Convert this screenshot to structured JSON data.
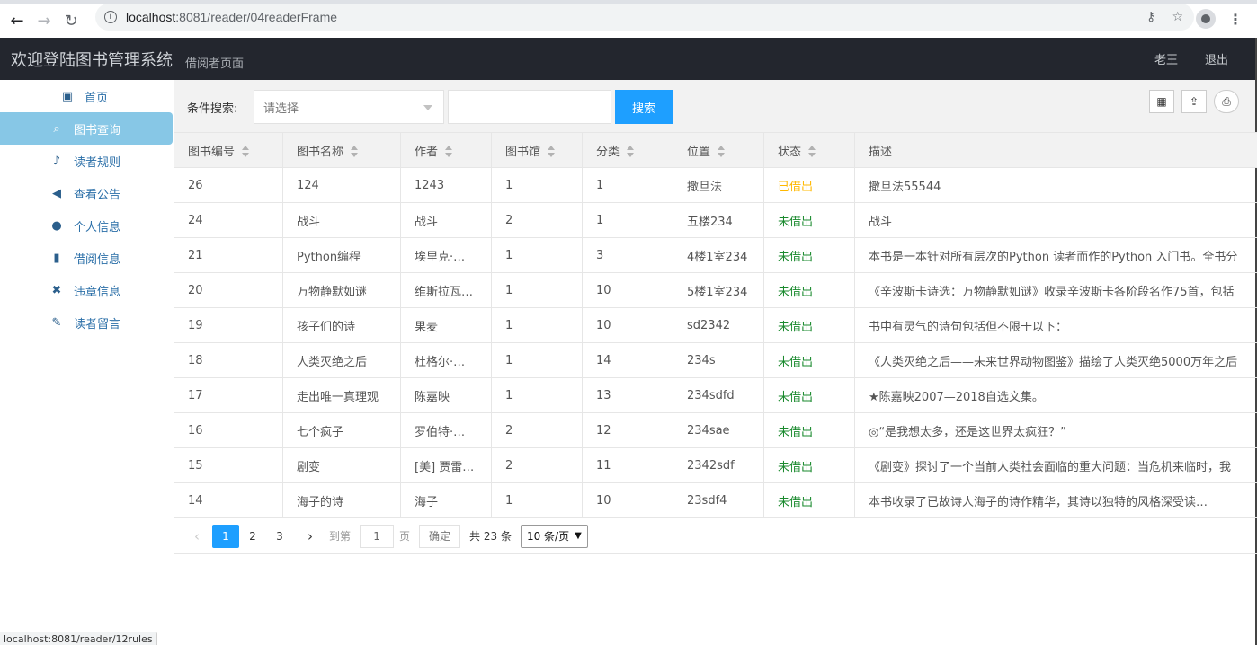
{
  "browser": {
    "url_host": "localhost",
    "url_path": ":8081/reader/04readerFrame",
    "status_url": "localhost:8081/reader/12rules"
  },
  "header": {
    "title": "欢迎登陆图书管理系统",
    "subtitle": "借阅者页面",
    "user": "老王",
    "logout": "退出"
  },
  "sidebar": {
    "items": [
      {
        "label": "首页",
        "icon": "image-icon"
      },
      {
        "label": "图书查询",
        "icon": "search-icon"
      },
      {
        "label": "读者规则",
        "icon": "bell-icon"
      },
      {
        "label": "查看公告",
        "icon": "bullhorn-icon"
      },
      {
        "label": "个人信息",
        "icon": "user-icon"
      },
      {
        "label": "借阅信息",
        "icon": "book-icon"
      },
      {
        "label": "违章信息",
        "icon": "remove-icon"
      },
      {
        "label": "读者留言",
        "icon": "pencil-icon"
      }
    ],
    "active": "图书查询"
  },
  "search": {
    "label": "条件搜索:",
    "select_placeholder": "请选择",
    "input_value": "",
    "button": "搜索"
  },
  "table": {
    "headers": [
      "图书编号",
      "图书名称",
      "作者",
      "图书馆",
      "分类",
      "位置",
      "状态",
      "描述"
    ],
    "rows": [
      [
        "26",
        "124",
        "1243",
        "1",
        "1",
        "撒旦法",
        "已借出",
        "撒旦法55544"
      ],
      [
        "24",
        "战斗",
        "战斗",
        "2",
        "1",
        "五楼234",
        "未借出",
        "战斗"
      ],
      [
        "21",
        "Python编程",
        "埃里克·…",
        "1",
        "3",
        "4楼1室234",
        "未借出",
        "本书是一本针对所有层次的Python 读者而作的Python 入门书。全书分"
      ],
      [
        "20",
        "万物静默如谜",
        "维斯拉瓦…",
        "1",
        "10",
        "5楼1室234",
        "未借出",
        "《辛波斯卡诗选：万物静默如谜》收录辛波斯卡各阶段名作75首，包括"
      ],
      [
        "19",
        "孩子们的诗",
        "果麦",
        "1",
        "10",
        "sd2342",
        "未借出",
        "书中有灵气的诗句包括但不限于以下："
      ],
      [
        "18",
        "人类灭绝之后",
        "杜格尔·…",
        "1",
        "14",
        "234s",
        "未借出",
        "《人类灭绝之后——未来世界动物图鉴》描绘了人类灭绝5000万年之后"
      ],
      [
        "17",
        "走出唯一真理观",
        "陈嘉映",
        "1",
        "13",
        "234sdfd",
        "未借出",
        "★陈嘉映2007—2018自选文集。"
      ],
      [
        "16",
        "七个疯子",
        "罗伯特·…",
        "2",
        "12",
        "234sae",
        "未借出",
        "◎“是我想太多，还是这世界太疯狂？”"
      ],
      [
        "15",
        "剧变",
        "[美] 贾雷…",
        "2",
        "11",
        "2342sdf",
        "未借出",
        "  《剧变》探讨了一个当前人类社会面临的重大问题：当危机来临时，我"
      ],
      [
        "14",
        "海子的诗",
        "海子",
        "1",
        "10",
        "23sdf4",
        "未借出",
        "本书收录了已故诗人海子的诗作精华，其诗以独特的风格深受读…"
      ]
    ]
  },
  "pager": {
    "pages": [
      "1",
      "2",
      "3"
    ],
    "current": "1",
    "goto_label": "到第",
    "goto_value": "1",
    "page_label": "页",
    "ok": "确定",
    "total": "共 23 条",
    "page_size": "10 条/页"
  },
  "colors": {
    "header_bg": "#23262e",
    "accent": "#1e9fff",
    "active_nav": "#87c7e6",
    "status_out": "#ffb800",
    "status_in": "#1a8a2e"
  }
}
